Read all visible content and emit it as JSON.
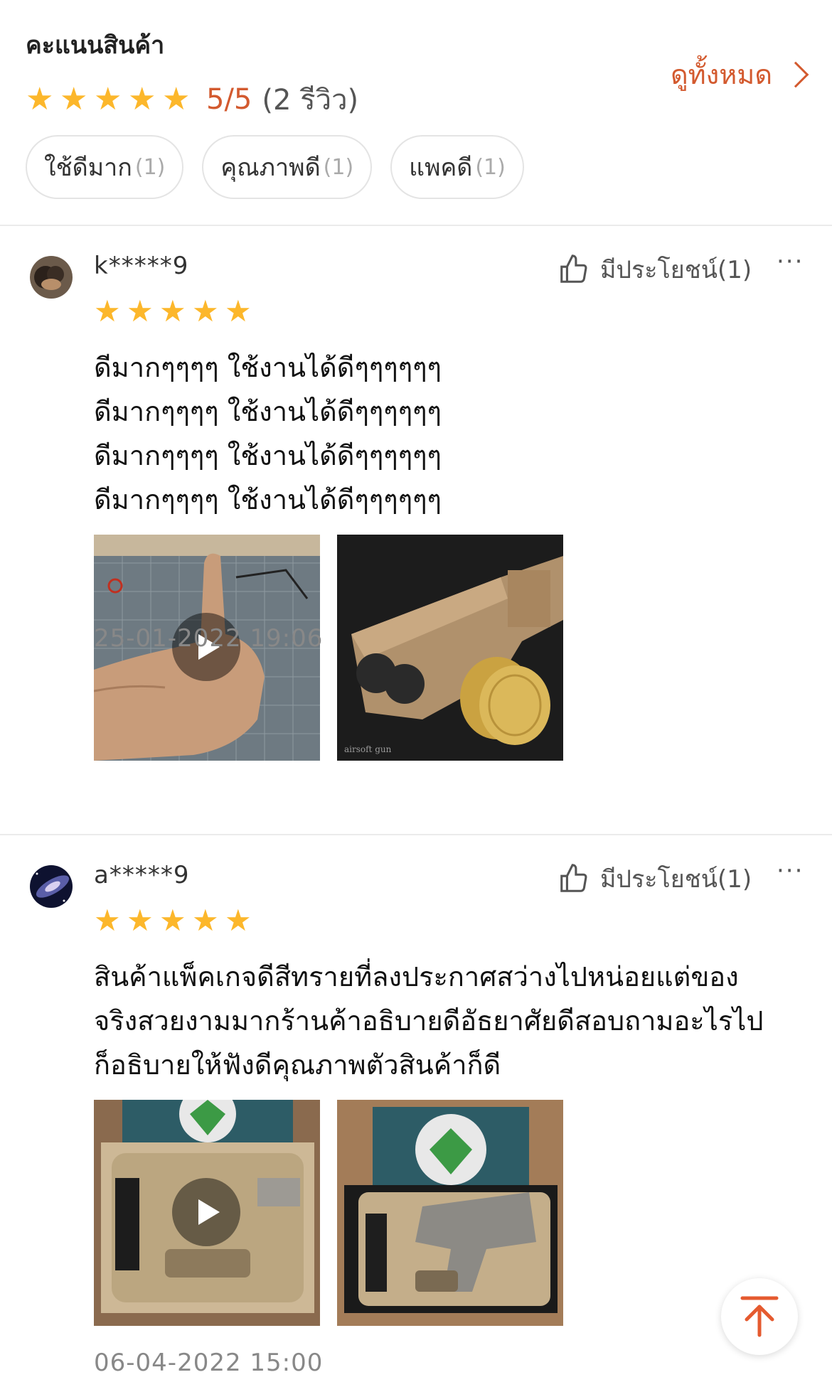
{
  "summary": {
    "title": "คะแนนสินค้า",
    "score": "5/5",
    "count": "(2 รีวิว)",
    "stars": 5,
    "see_all": "ดูทั้งหมด",
    "tags": [
      {
        "label": "ใช้ดีมาก",
        "count": "(1)"
      },
      {
        "label": "คุณภาพดี",
        "count": "(1)"
      },
      {
        "label": "แพคดี",
        "count": "(1)"
      }
    ]
  },
  "reviews": [
    {
      "user": "k*****9",
      "helpful": "มีประโยชน์(1)",
      "more": "···",
      "stars": 5,
      "text": "ดีมากๆๆๆๆ ใช้งานได้ดีๆๆๆๆๆๆ\nดีมากๆๆๆๆ ใช้งานได้ดีๆๆๆๆๆๆ\nดีมากๆๆๆๆ ใช้งานได้ดีๆๆๆๆๆๆ\nดีมากๆๆๆๆ ใช้งานได้ดีๆๆๆๆๆๆ",
      "media": [
        {
          "kind": "video",
          "label": ""
        },
        {
          "kind": "photo",
          "label": "airsoft gun"
        }
      ],
      "date": "25-01-2022 19:06"
    },
    {
      "user": "a*****9",
      "helpful": "มีประโยชน์(1)",
      "more": "···",
      "stars": 5,
      "text": "สินค้าแพ็คเกจดีสีทรายที่ลงประกาศสว่างไปหน่อยแต่ของ\nจริงสวยงามมากร้านค้าอธิบายดีอัธยาศัยดีสอบถามอะไรไป\nก็อธิบายให้ฟังดีคุณภาพตัวสินค้าก็ดี",
      "media": [
        {
          "kind": "video",
          "label": ""
        },
        {
          "kind": "photo",
          "label": ""
        }
      ],
      "date": "06-04-2022 15:00"
    }
  ],
  "colors": {
    "accent": "#d35a2f",
    "star": "#fcb72b"
  },
  "icons": {
    "helpful": "thumbs-up-icon",
    "see_all": "chevron-right-icon",
    "top": "back-to-top-icon"
  }
}
